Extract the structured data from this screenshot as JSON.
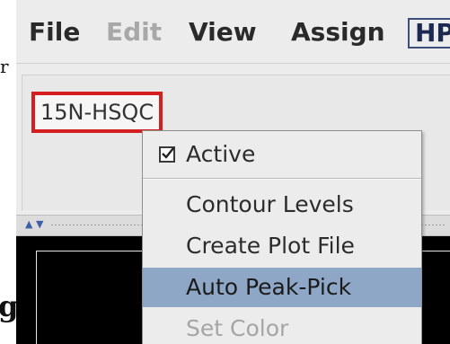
{
  "document": {
    "fragment_top": "r",
    "fragment_bottom": "g"
  },
  "menubar": {
    "file_label": "File",
    "edit_label": "Edit",
    "view_label": "View",
    "assign_label": "Assign",
    "hp_label": "HP"
  },
  "spectrum_tabs": {
    "active_tab_label": "15N-HSQC"
  },
  "context_menu": {
    "active_label": "Active",
    "active_checked": true,
    "contour_levels_label": "Contour Levels",
    "create_plot_file_label": "Create Plot File",
    "auto_peak_pick_label": "Auto Peak-Pick",
    "set_color_label": "Set Color",
    "highlighted_item": "Auto Peak-Pick",
    "disabled_item": "Set Color"
  },
  "colors": {
    "tab_highlight_border": "#d31f1f",
    "menu_highlight": "#8ea7c7",
    "spectrum_background": "#000000",
    "splitter_arrow": "#3d5fa8"
  },
  "icons": {
    "checkbox": "checkbox-checked-icon",
    "splitter_up": "triangle-up-icon",
    "splitter_down": "triangle-down-icon"
  }
}
